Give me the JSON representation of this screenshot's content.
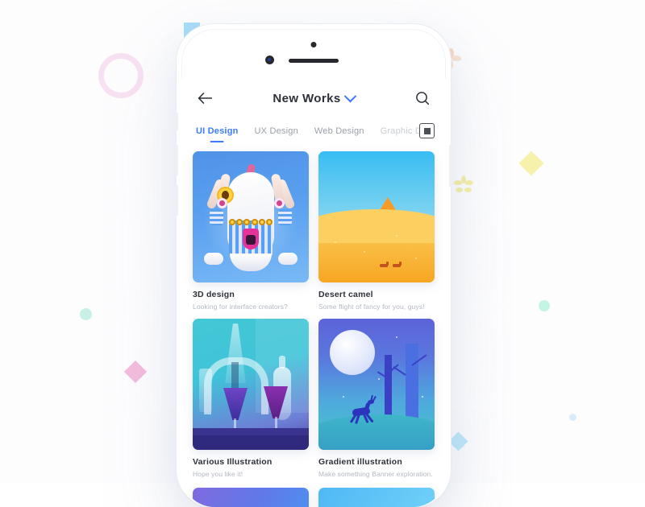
{
  "app": {
    "navbar": {
      "title": "New Works",
      "back_icon": "arrow-left-icon",
      "dropdown_icon": "chevron-down-icon",
      "search_icon": "search-icon"
    },
    "tabs": [
      {
        "label": "UI Design",
        "active": true
      },
      {
        "label": "UX Design",
        "active": false
      },
      {
        "label": "Web Design",
        "active": false
      },
      {
        "label": "Graphic D",
        "active": false
      }
    ],
    "view_toggle_icon": "grid-view-icon",
    "cards": [
      {
        "title": "3D design",
        "subtitle": "Looking for interface creators?"
      },
      {
        "title": "Desert camel",
        "subtitle": "Some flight of fancy for you, guys!"
      },
      {
        "title": "Various Illustration",
        "subtitle": "Hope you like it!"
      },
      {
        "title": "Gradient illustration",
        "subtitle": "Make something Banner exploration."
      }
    ]
  },
  "colors": {
    "accent": "#3d7bfb",
    "title_text": "#2d313a",
    "muted_text": "#b3b8c2",
    "tab_inactive": "#9aa0ab",
    "page_background": "#fdfdfe",
    "deco_pink_ring": "#f6d7ee",
    "deco_cyan_cross": "#9fdcf7",
    "deco_yellow_cross": "#f6f0a8",
    "deco_pink_cross": "#f3b9da",
    "deco_mint_dot": "#b9f2e2",
    "deco_peach": "#f6d6c2"
  }
}
